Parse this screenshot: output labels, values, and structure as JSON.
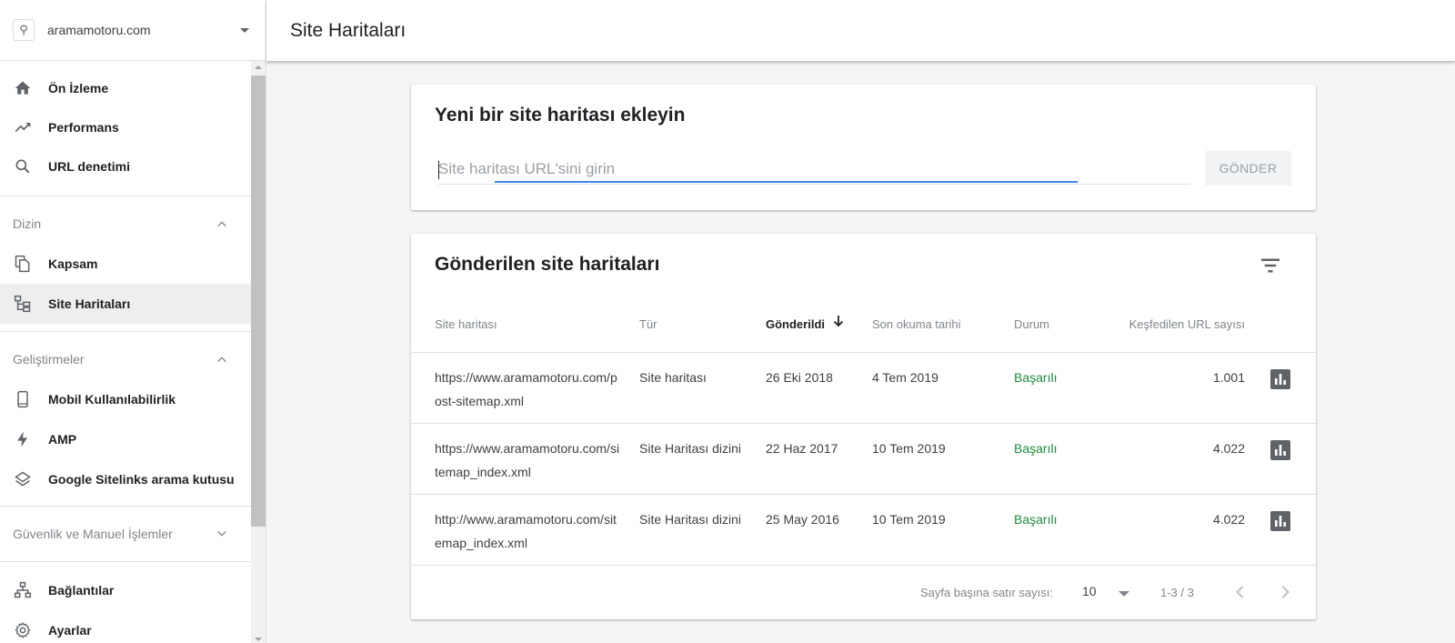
{
  "property": {
    "name": "aramamotoru.com"
  },
  "sidebar": {
    "items_top": [
      {
        "label": "Ön İzleme",
        "icon": "home-icon"
      },
      {
        "label": "Performans",
        "icon": "trending-up-icon"
      },
      {
        "label": "URL denetimi",
        "icon": "search-icon"
      }
    ],
    "section_index": {
      "label": "Dizin",
      "items": [
        {
          "label": "Kapsam",
          "icon": "copy-icon"
        },
        {
          "label": "Site Haritaları",
          "icon": "sitemap-icon",
          "active": true
        }
      ]
    },
    "section_enhancements": {
      "label": "Geliştirmeler",
      "items": [
        {
          "label": "Mobil Kullanılabilirlik",
          "icon": "smartphone-icon"
        },
        {
          "label": "AMP",
          "icon": "bolt-icon"
        },
        {
          "label": "Google Sitelinks arama kutusu",
          "icon": "layers-icon"
        }
      ]
    },
    "section_security": {
      "label": "Güvenlik ve Manuel İşlemler"
    },
    "items_bottom": [
      {
        "label": "Bağlantılar",
        "icon": "links-icon"
      },
      {
        "label": "Ayarlar",
        "icon": "gear-icon"
      }
    ]
  },
  "header": {
    "title": "Site Haritaları"
  },
  "add_card": {
    "title": "Yeni bir site haritası ekleyin",
    "input_placeholder": "Site haritası URL'sini girin",
    "input_value": "",
    "submit_label": "GÖNDER"
  },
  "submitted_card": {
    "title": "Gönderilen site haritaları",
    "columns": {
      "sitemap": "Site haritası",
      "type": "Tür",
      "submitted": "Gönderildi",
      "last_read": "Son okuma tarihi",
      "status": "Durum",
      "discovered": "Keşfedilen URL sayısı"
    },
    "rows": [
      {
        "url": "https://www.aramamotoru.com/post-sitemap.xml",
        "type": "Site haritası",
        "submitted": "26 Eki 2018",
        "last_read": "4 Tem 2019",
        "status": "Başarılı",
        "discovered": "1.001"
      },
      {
        "url": "https://www.aramamotoru.com/sitemap_index.xml",
        "type": "Site Haritası dizini",
        "submitted": "22 Haz 2017",
        "last_read": "10 Tem 2019",
        "status": "Başarılı",
        "discovered": "4.022"
      },
      {
        "url": "http://www.aramamotoru.com/sitemap_index.xml",
        "type": "Site Haritası dizini",
        "submitted": "25 May 2016",
        "last_read": "10 Tem 2019",
        "status": "Başarılı",
        "discovered": "4.022"
      }
    ],
    "footer": {
      "rows_per_page_label": "Sayfa başına satır sayısı:",
      "rows_per_page_value": "10",
      "range": "1-3 / 3"
    }
  },
  "colors": {
    "success": "#1e8e3e",
    "focus": "#4285f4",
    "active_bg": "#eeeeee"
  }
}
